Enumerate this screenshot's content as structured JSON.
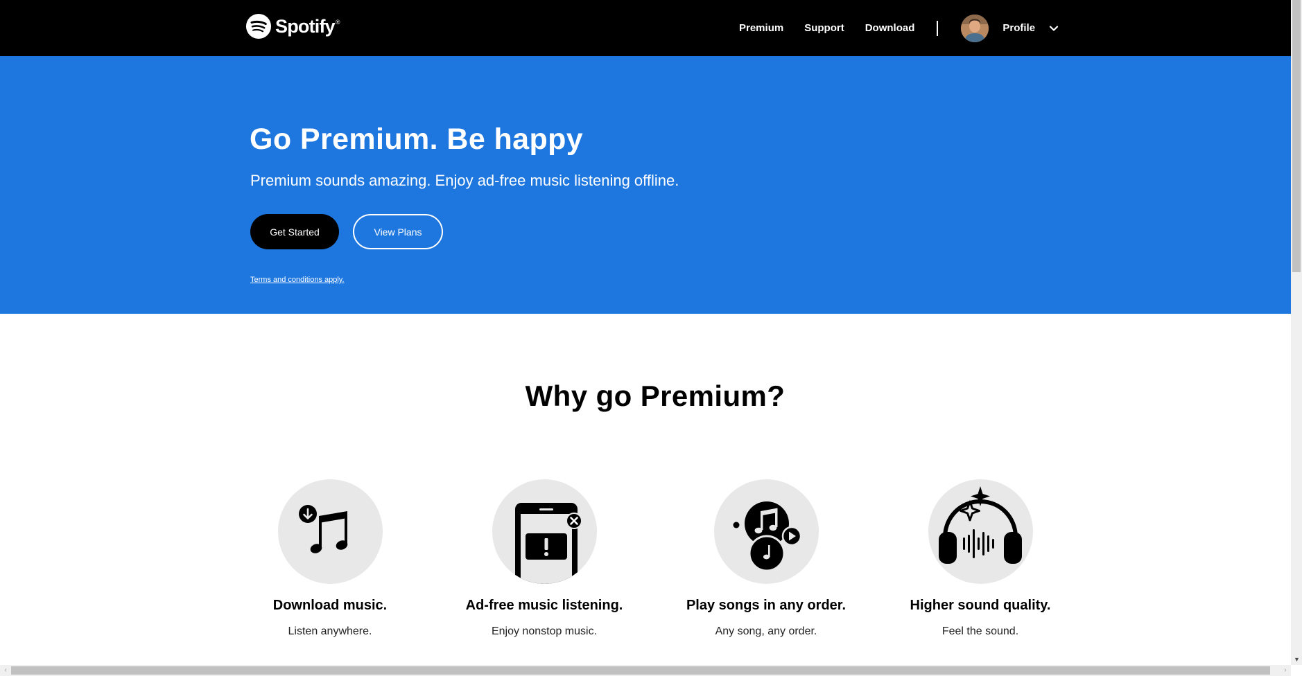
{
  "nav": {
    "logo_text": "Spotify",
    "logo_tm": "®",
    "links": [
      "Premium",
      "Support",
      "Download"
    ],
    "profile_label": "Profile"
  },
  "hero": {
    "title": "Go Premium. Be happy",
    "subtitle": "Premium sounds amazing. Enjoy ad-free music listening offline.",
    "primary_button": "Get Started",
    "secondary_button": "View Plans",
    "terms": "Terms and conditions apply."
  },
  "why": {
    "title": "Why go Premium?",
    "features": [
      {
        "title": "Download music.",
        "subtitle": "Listen anywhere.",
        "icon": "download-music-icon"
      },
      {
        "title": "Ad-free music listening.",
        "subtitle": "Enjoy nonstop music.",
        "icon": "ad-free-icon"
      },
      {
        "title": "Play songs in any order.",
        "subtitle": "Any song, any order.",
        "icon": "shuffle-play-icon"
      },
      {
        "title": "Higher sound quality.",
        "subtitle": "Feel the sound.",
        "icon": "headphones-icon"
      }
    ]
  },
  "colors": {
    "nav_bg": "#000000",
    "hero_bg": "#1e77df",
    "feature_circle": "#e8e8e8"
  }
}
